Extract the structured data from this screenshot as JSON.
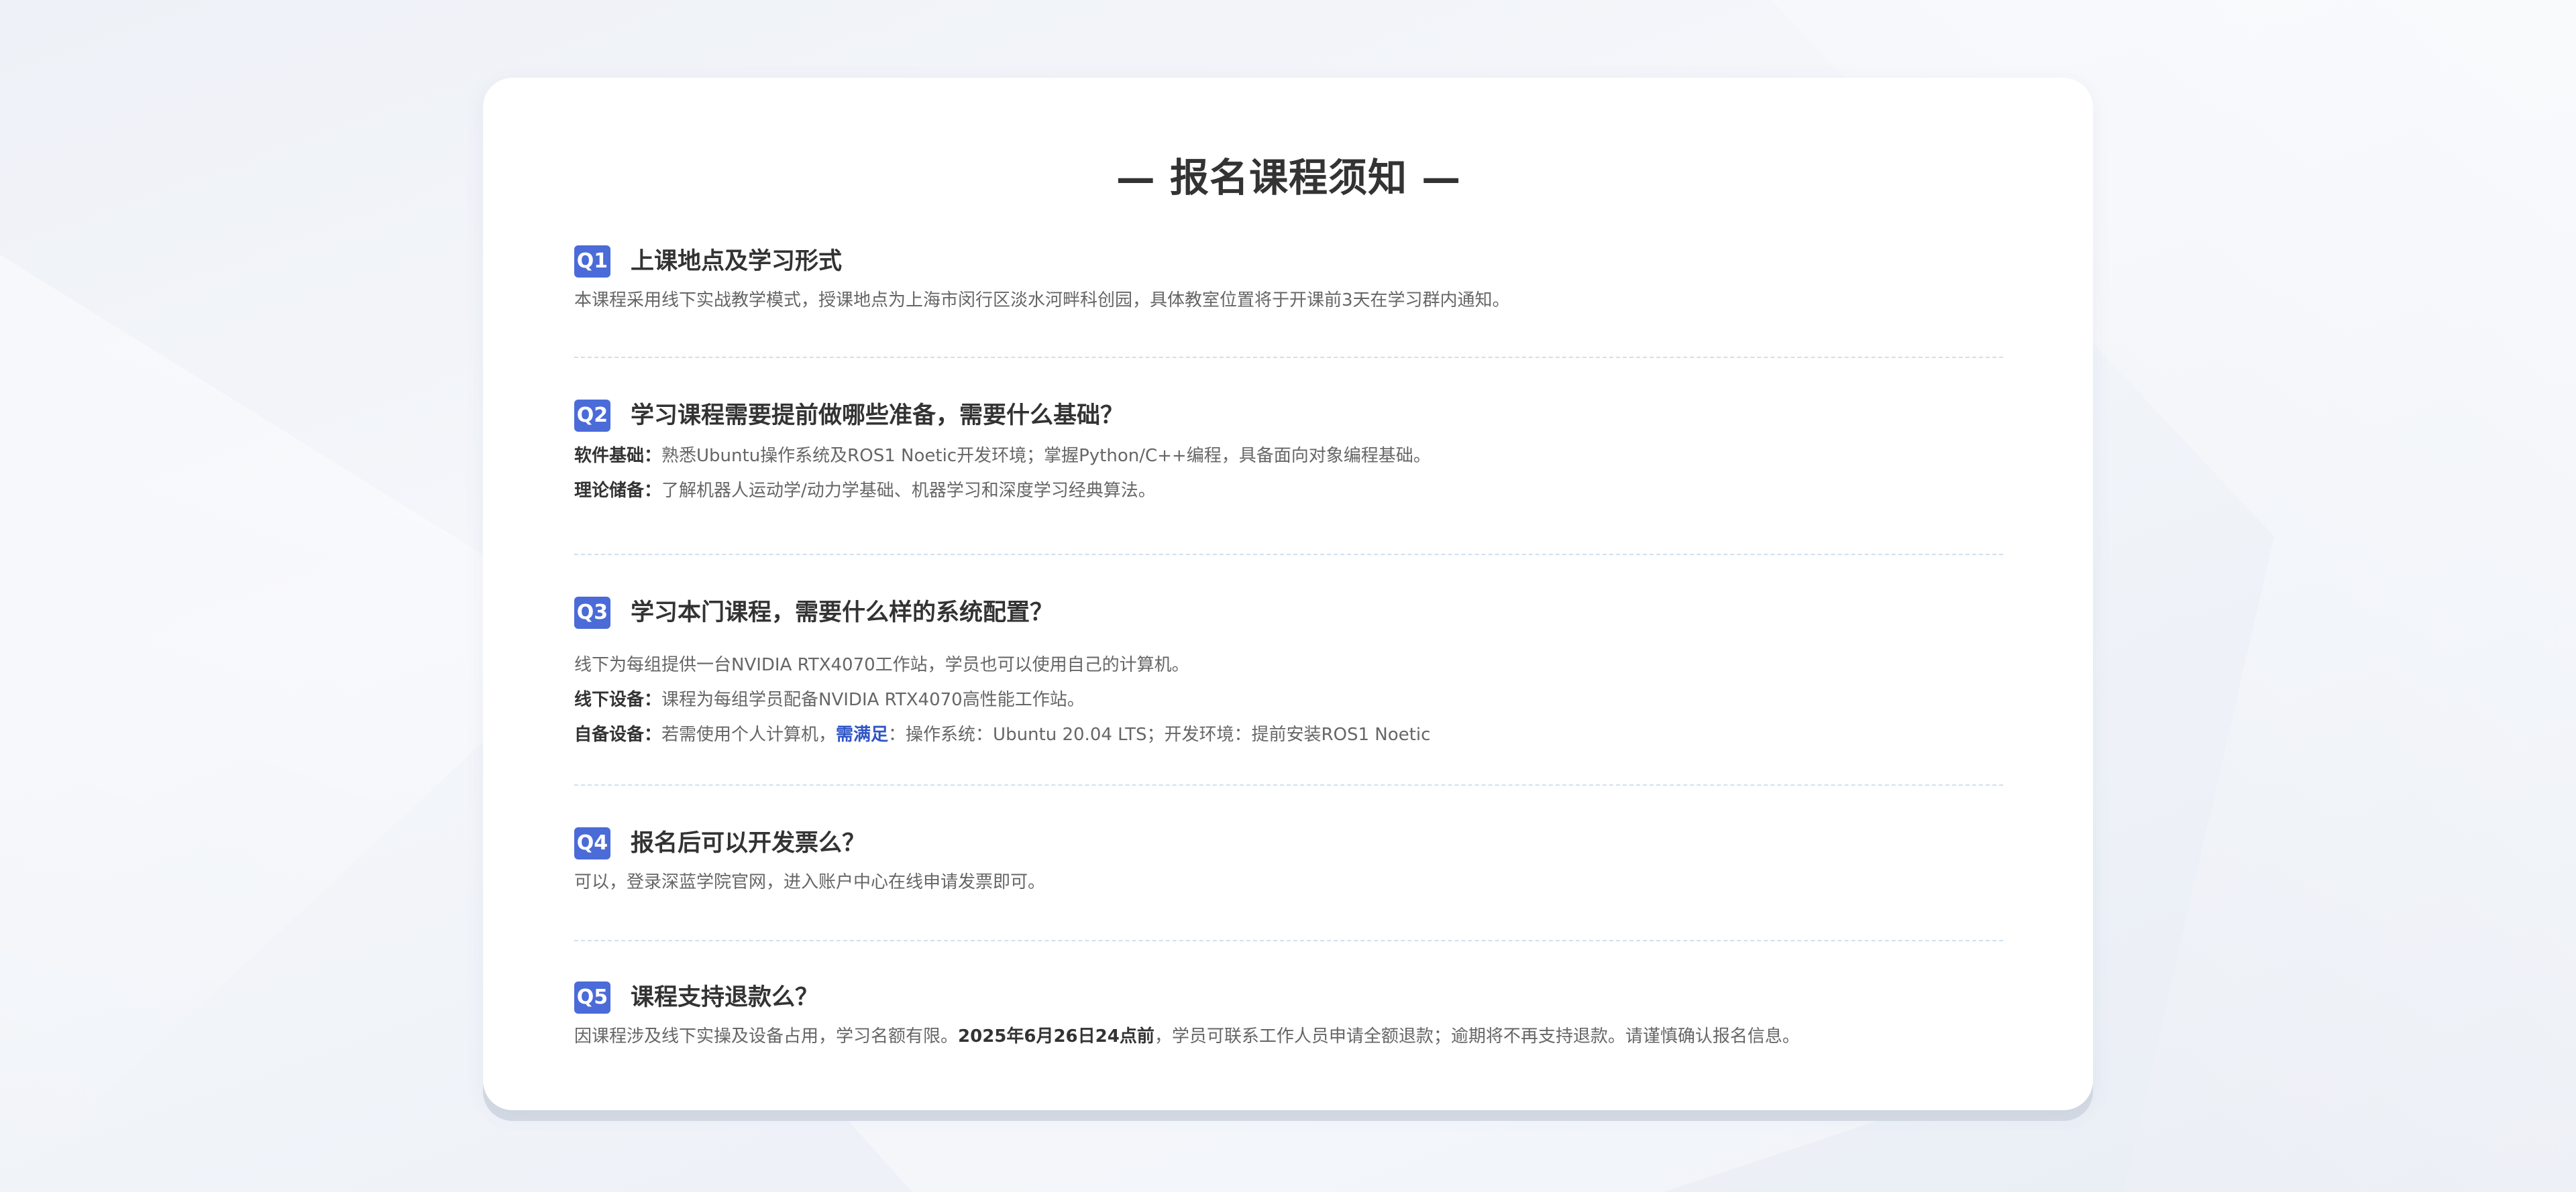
{
  "page": {
    "title": "— 报名课程须知 —"
  },
  "colors": {
    "badge": "#4a6bd8",
    "highlight": "#2f55c6",
    "divider": "#cfe0ef"
  },
  "faq": [
    {
      "badge": "Q1",
      "question": "上课地点及学习形式",
      "lines": [
        {
          "text": "本课程采用线下实战教学模式，授课地点为上海市闵行区淡水河畔科创园，具体教室位置将于开课前3天在学习群内通知。"
        }
      ]
    },
    {
      "badge": "Q2",
      "question": "学习课程需要提前做哪些准备，需要什么基础？",
      "lines": [
        {
          "label": "软件基础：",
          "text": "熟悉Ubuntu操作系统及ROS1 Noetic开发环境；掌握Python/C++编程，具备面向对象编程基础。"
        },
        {
          "label": "理论储备：",
          "text": "了解机器人运动学/动力学基础、机器学习和深度学习经典算法。"
        }
      ]
    },
    {
      "badge": "Q3",
      "question": "学习本门课程，需要什么样的系统配置？",
      "lines": [
        {
          "text": "线下为每组提供一台NVIDIA RTX4070工作站，学员也可以使用自己的计算机。"
        },
        {
          "label": "线下设备：",
          "text": "课程为每组学员配备NVIDIA RTX4070高性能工作站。"
        },
        {
          "label": "自备设备：",
          "text": "若需使用个人计算机，",
          "highlight": "需满足",
          "text_after": "：操作系统：Ubuntu 20.04 LTS；开发环境：提前安装ROS1 Noetic"
        }
      ]
    },
    {
      "badge": "Q4",
      "question": "报名后可以开发票么？",
      "lines": [
        {
          "text": "可以，登录深蓝学院官网，进入账户中心在线申请发票即可。"
        }
      ]
    },
    {
      "badge": "Q5",
      "question": "课程支持退款么？",
      "lines": [
        {
          "text": "因课程涉及线下实操及设备占用，学习名额有限。",
          "strong": "2025年6月26日24点前",
          "text_after": "，学员可联系工作人员申请全额退款；逾期将不再支持退款。请谨慎确认报名信息。"
        }
      ]
    }
  ]
}
